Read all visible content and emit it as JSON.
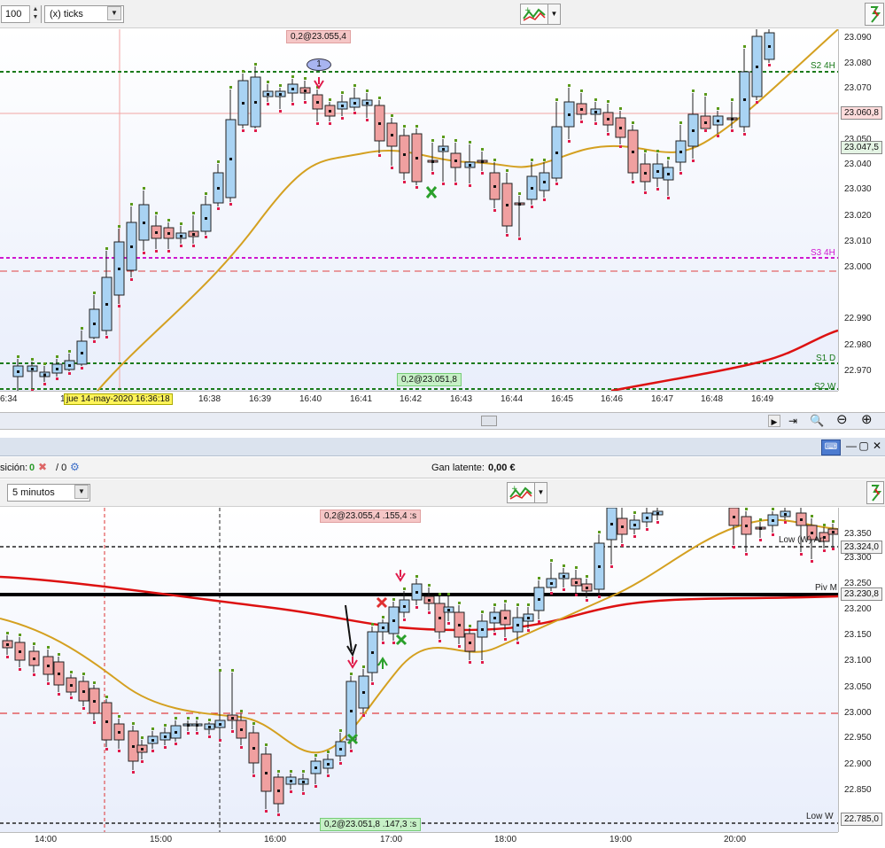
{
  "top_toolbar": {
    "quantity": "100",
    "timeframe": "(x) ticks"
  },
  "top_chart": {
    "price_ticks": [
      "23.090",
      "23.080",
      "23.070",
      "23.050",
      "23.040",
      "23.030",
      "23.020",
      "23.010",
      "23.000",
      "22.990",
      "22.980",
      "22.970"
    ],
    "time_ticks": [
      "6:34",
      "16:3",
      "16:38",
      "16:39",
      "16:40",
      "16:41",
      "16:42",
      "16:43",
      "16:44",
      "16:45",
      "16:46",
      "16:47",
      "16:48",
      "16:49"
    ],
    "cursor_date": "jue 14-may-2020 16:36:18",
    "order_top": "0,2@23.055,4",
    "order_bottom": "0,2@23.051,8",
    "badge_last": "23.060,8",
    "badge_ma": "23.047,5",
    "marker_num": "1",
    "lines": {
      "s2_4h": "S2 4H",
      "s3_4h": "S3 4H",
      "s1_d": "S1 D",
      "s2_w": "S2 W"
    }
  },
  "position_bar": {
    "label": "sición:",
    "count_1": "0",
    "count_2": "/ 0",
    "gain_label": "Gan latente:",
    "gain_value": "0,00 €"
  },
  "bottom_toolbar": {
    "timeframe": "5 minutos"
  },
  "bottom_chart": {
    "price_ticks": [
      "23.350",
      "23.300",
      "23.250",
      "23.200",
      "23.150",
      "23.100",
      "23.050",
      "23.000",
      "22.950",
      "22.900",
      "22.850"
    ],
    "time_ticks": [
      "14:00",
      "15:00",
      "16:00",
      "17:00",
      "18:00",
      "19:00",
      "20:00"
    ],
    "order_top": "0,2@23.055,4",
    "order_top_extra": ".155,4 :s",
    "order_bottom": "0,2@23.051,8",
    "order_bottom_extra": ".147,3 :s",
    "badge_low": "23.324,0",
    "badge_piv": "23.230,8",
    "badge_lowm": "22.785,0",
    "lines": {
      "low_vol": "Low (W) An",
      "piv": "Piv M",
      "low_w": "Low W"
    }
  },
  "colors": {
    "bull": "#a9d3f3",
    "bear": "#f0a0a0",
    "ma_gold": "#d4a020",
    "ma_red": "#dd1111"
  }
}
